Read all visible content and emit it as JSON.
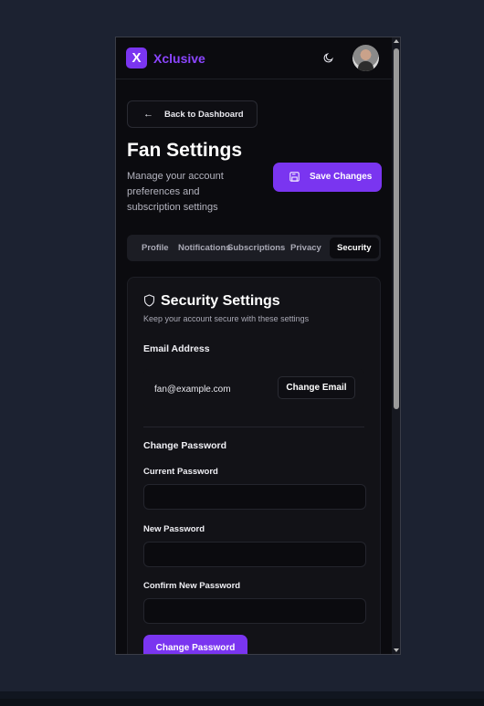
{
  "header": {
    "logo_letter": "X",
    "brand": "Xclusive",
    "theme_toggle_icon": "moon-icon",
    "avatar_icon": "user-avatar"
  },
  "page": {
    "back_label": "Back to Dashboard",
    "title": "Fan Settings",
    "subtitle": "Manage your account preferences and subscription settings",
    "save_label": "Save Changes"
  },
  "tabs": [
    {
      "label": "Profile",
      "active": false
    },
    {
      "label": "Notifications",
      "active": false
    },
    {
      "label": "Subscriptions",
      "active": false
    },
    {
      "label": "Privacy",
      "active": false
    },
    {
      "label": "Security",
      "active": true
    }
  ],
  "security": {
    "title": "Security Settings",
    "subtitle": "Keep your account secure with these settings",
    "email_heading": "Email Address",
    "email_value": "fan@example.com",
    "change_email_label": "Change Email",
    "password_heading": "Change Password",
    "current_password_label": "Current Password",
    "current_password_value": "",
    "new_password_label": "New Password",
    "new_password_value": "",
    "confirm_password_label": "Confirm New Password",
    "confirm_password_value": "",
    "change_password_label": "Change Password"
  },
  "colors": {
    "accent": "#7a35f0",
    "brand": "#8b45ff",
    "background": "#0b0b0f",
    "outer_background": "#1c2231"
  }
}
